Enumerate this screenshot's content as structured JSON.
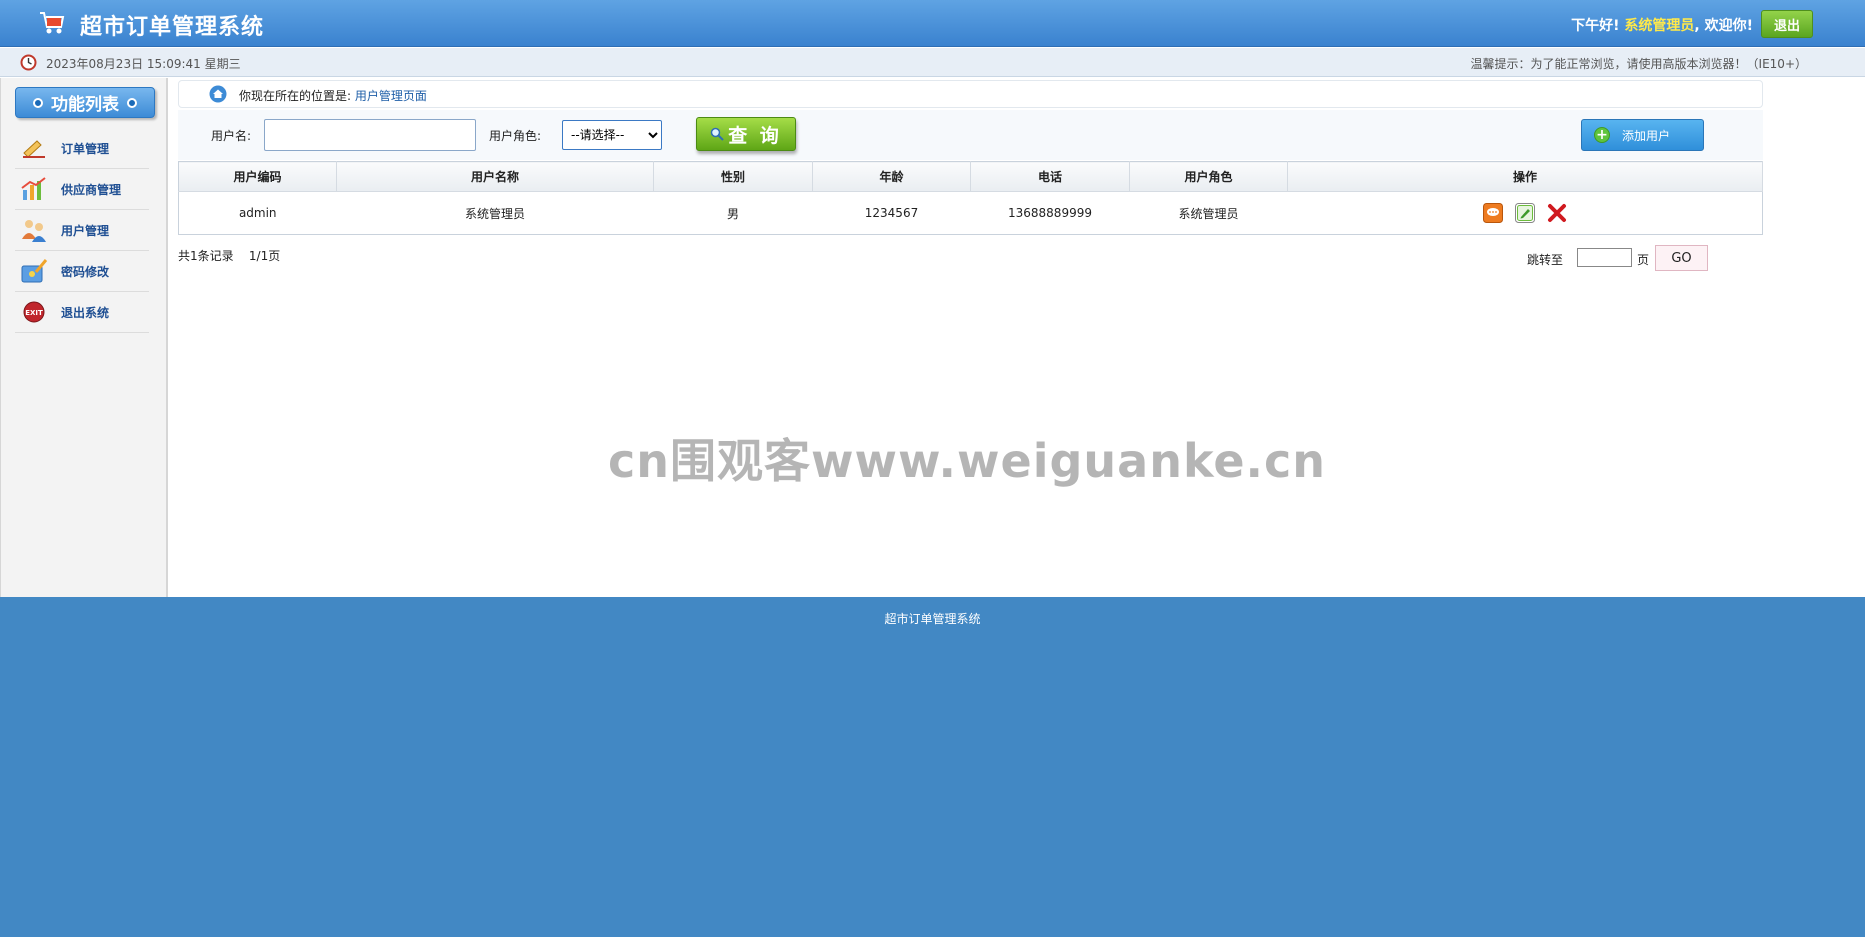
{
  "header": {
    "title": "超市订单管理系统",
    "greeting_prefix": "下午好!",
    "username": "系统管理员",
    "greeting_suffix": ", 欢迎你!",
    "logout_label": "退出"
  },
  "subbar": {
    "datetime": "2023年08月23日 15:09:41 星期三",
    "tip": "温馨提示：为了能正常浏览，请使用高版本浏览器！（IE10+）"
  },
  "sidebar": {
    "title": "功能列表",
    "items": [
      {
        "label": "订单管理",
        "icon": "order-icon"
      },
      {
        "label": "供应商管理",
        "icon": "supplier-icon"
      },
      {
        "label": "用户管理",
        "icon": "users-icon"
      },
      {
        "label": "密码修改",
        "icon": "password-icon"
      },
      {
        "label": "退出系统",
        "icon": "exit-icon"
      }
    ]
  },
  "breadcrumb": {
    "prefix": "你现在所在的位置是:",
    "current": "用户管理页面"
  },
  "search": {
    "username_label": "用户名:",
    "username_value": "",
    "role_label": "用户角色:",
    "role_selected": "--请选择--",
    "query_label": "查 询",
    "add_label": "添加用户"
  },
  "table": {
    "headers": [
      "用户编码",
      "用户名称",
      "性别",
      "年龄",
      "电话",
      "用户角色",
      "操作"
    ],
    "rows": [
      {
        "code": "admin",
        "name": "系统管理员",
        "gender": "男",
        "age": "1234567",
        "phone": "13688889999",
        "role": "系统管理员"
      }
    ],
    "actions": [
      "view-icon",
      "edit-icon",
      "delete-icon"
    ]
  },
  "pagination": {
    "total_text": "共1条记录",
    "page_text": "1/1页",
    "jump_label": "跳转至",
    "page_unit": "页",
    "go_label": "GO"
  },
  "watermark": "cn围观客www.weiguanke.cn",
  "footer": {
    "text": "超市订单管理系统"
  },
  "colors": {
    "header": "#3a82cf",
    "accent_yellow": "#ffe94a",
    "green_button": "#5ea616",
    "footer": "#4288c4"
  }
}
